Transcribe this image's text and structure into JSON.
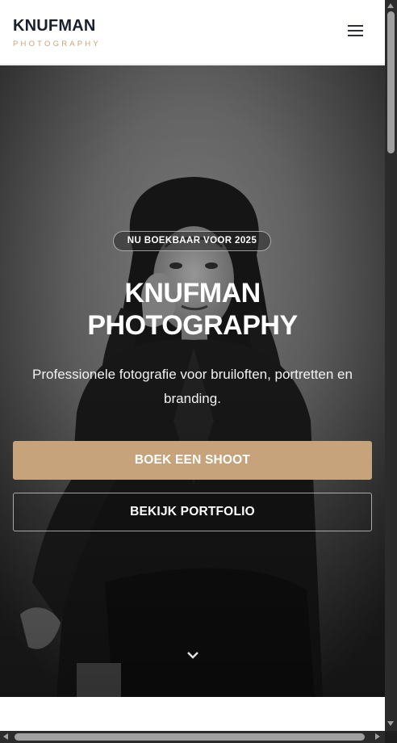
{
  "header": {
    "brand_name": "KNUFMAN",
    "brand_sub": "PHOTOGRAPHY",
    "menu_icon": "hamburger-menu-icon"
  },
  "hero": {
    "badge": "NU BOEKBAAR VOOR 2025",
    "title_line1": "KNUFMAN",
    "title_line2": "PHOTOGRAPHY",
    "description": "Professionele fotografie voor bruiloften, portretten en branding.",
    "primary_button": "BOEK EEN SHOOT",
    "secondary_button": "BEKIJK PORTFOLIO",
    "scroll_icon": "chevron-down-icon",
    "image": "black-and-white portrait of woman with long curly hair, hand on cheek"
  },
  "colors": {
    "accent": "#c6a37b",
    "brand_dark": "#1a1f2b",
    "scrollbar_track": "#2b2b2b",
    "scrollbar_thumb": "#a0a0a0"
  }
}
